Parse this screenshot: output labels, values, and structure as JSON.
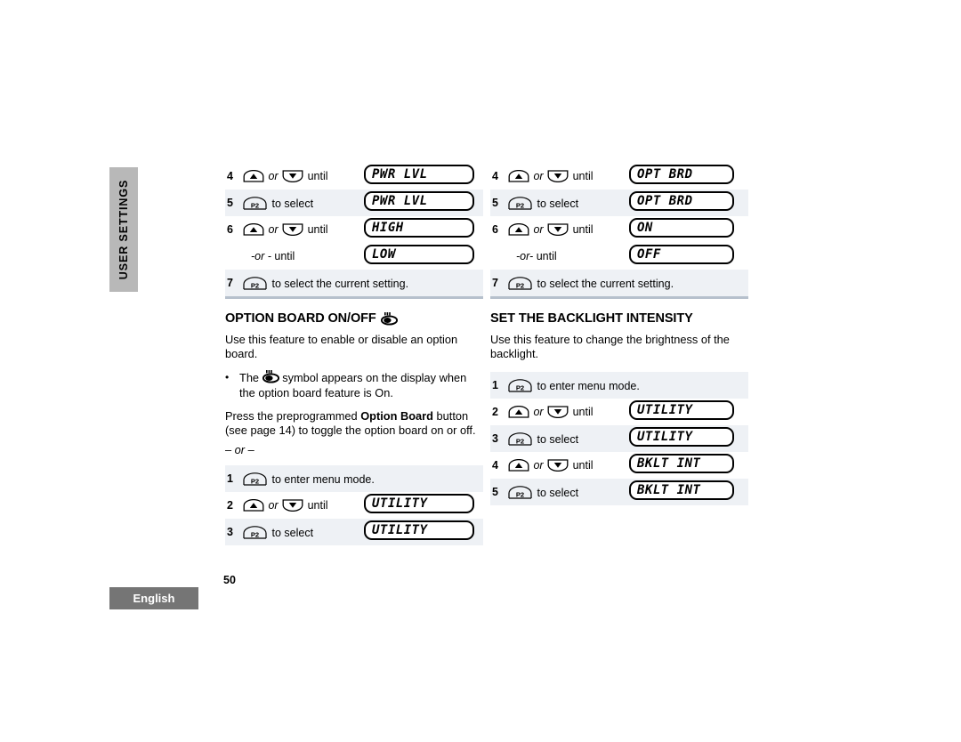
{
  "sidebar": {
    "chapter_tab": "USER SETTINGS",
    "language_tab": "English"
  },
  "page_number": "50",
  "icons": {
    "up_button": "up-arrow-button-icon",
    "down_button": "down-arrow-button-icon",
    "p2_button_label": "P2",
    "option_board_symbol": "option-board-symbol-icon"
  },
  "left_column": {
    "top_steps": {
      "rows": [
        {
          "num": "4",
          "pre": "",
          "mid": "or",
          "post": "until",
          "type": "updown",
          "lcd": "PWR LVL",
          "shaded": false
        },
        {
          "num": "5",
          "pre": "",
          "mid": "",
          "post": "to select",
          "type": "p2",
          "lcd": "PWR LVL",
          "shaded": true
        },
        {
          "num": "6",
          "pre": "",
          "mid": "or",
          "post": "until",
          "type": "updown",
          "lcd": "HIGH",
          "shaded": false
        },
        {
          "num": "",
          "pre": "-or -",
          "mid": "",
          "post": "until",
          "type": "oronly",
          "lcd": "LOW",
          "shaded": false
        },
        {
          "num": "7",
          "pre": "",
          "mid": "",
          "post": "to select the current setting.",
          "type": "p2wide",
          "lcd": "",
          "shaded": true
        }
      ]
    },
    "heading": "OPTION BOARD ON/OFF",
    "heading_has_symbol": true,
    "paragraph_1": "Use this feature to enable or disable an option board.",
    "bullet_1_part_a": "The",
    "bullet_1_part_b": "symbol appears on the display when the option board feature is On.",
    "paragraph_2_a": "Press the preprogrammed ",
    "paragraph_2_bold": "Option Board",
    "paragraph_2_b": " button (see page 14) to toggle the option board on or off.",
    "or_separator": "– or –",
    "bottom_steps": {
      "rows": [
        {
          "num": "1",
          "pre": "",
          "mid": "",
          "post": "to enter menu mode.",
          "type": "p2wide",
          "lcd": "",
          "shaded": true
        },
        {
          "num": "2",
          "pre": "",
          "mid": "or",
          "post": "until",
          "type": "updown",
          "lcd": "UTILITY",
          "shaded": false
        },
        {
          "num": "3",
          "pre": "",
          "mid": "",
          "post": "to select",
          "type": "p2",
          "lcd": "UTILITY",
          "shaded": true
        }
      ]
    }
  },
  "right_column": {
    "top_steps": {
      "rows": [
        {
          "num": "4",
          "pre": "",
          "mid": "or",
          "post": "until",
          "type": "updown",
          "lcd": "OPT BRD",
          "shaded": false
        },
        {
          "num": "5",
          "pre": "",
          "mid": "",
          "post": "to select",
          "type": "p2",
          "lcd": "OPT BRD",
          "shaded": true
        },
        {
          "num": "6",
          "pre": "",
          "mid": "or",
          "post": "until",
          "type": "updown",
          "lcd": "ON",
          "shaded": false
        },
        {
          "num": "",
          "pre": "-or- ",
          "mid": "",
          "post": "until",
          "type": "oronly",
          "lcd": "OFF",
          "shaded": false
        },
        {
          "num": "7",
          "pre": "",
          "mid": "",
          "post": "to select the current setting.",
          "type": "p2wide",
          "lcd": "",
          "shaded": true
        }
      ]
    },
    "heading": "SET THE BACKLIGHT INTENSITY",
    "heading_has_symbol": false,
    "paragraph_1": "Use this feature to change the brightness of the backlight.",
    "bottom_steps": {
      "rows": [
        {
          "num": "1",
          "pre": "",
          "mid": "",
          "post": "to enter menu mode.",
          "type": "p2wide",
          "lcd": "",
          "shaded": true
        },
        {
          "num": "2",
          "pre": "",
          "mid": "or",
          "post": "until",
          "type": "updown",
          "lcd": "UTILITY",
          "shaded": false
        },
        {
          "num": "3",
          "pre": "",
          "mid": "",
          "post": "to select",
          "type": "p2",
          "lcd": "UTILITY",
          "shaded": true
        },
        {
          "num": "4",
          "pre": "",
          "mid": "or",
          "post": "until",
          "type": "updown",
          "lcd": "BKLT INT",
          "shaded": false
        },
        {
          "num": "5",
          "pre": "",
          "mid": "",
          "post": "to select",
          "type": "p2",
          "lcd": "BKLT INT",
          "shaded": true
        }
      ]
    }
  },
  "colors": {
    "row_shade": "#eef1f5",
    "rule": "#b6c0cc",
    "chapter_tab_bg": "#b8b8b8",
    "language_tab_bg": "#757575"
  }
}
